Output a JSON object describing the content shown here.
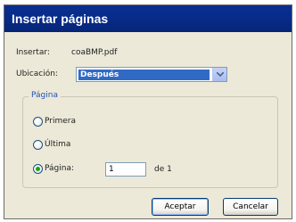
{
  "dialog": {
    "title": "Insertar páginas",
    "insert_label": "Insertar:",
    "insert_file": "coaBMP.pdf",
    "location_label": "Ubicación:",
    "location_value": "Después",
    "group_title": "Página",
    "options": [
      {
        "label": "Primera",
        "selected": false
      },
      {
        "label": "Última",
        "selected": false
      },
      {
        "label": "Página:",
        "selected": true
      }
    ],
    "page_value": "1",
    "page_total": "de 1",
    "ok_label": "Aceptar",
    "cancel_label": "Cancelar"
  },
  "colors": {
    "titlebar": "#0a2f92",
    "dialog_bg": "#ece9d8",
    "selection": "#316ac5",
    "group_title": "#2350b8",
    "radio_dot": "#21a121"
  }
}
